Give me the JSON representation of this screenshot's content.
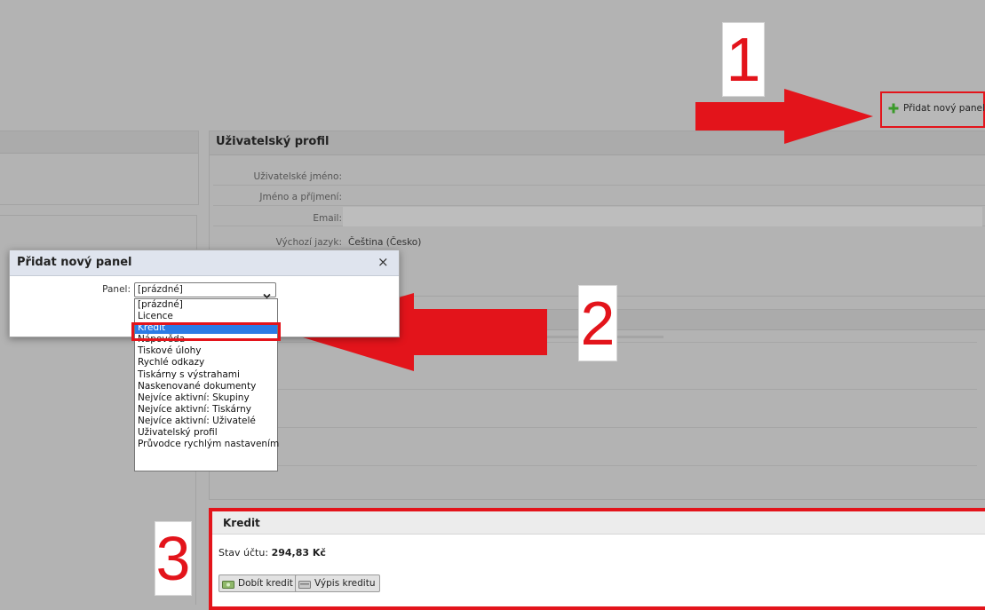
{
  "toolbar": {
    "add_panel_label": "Přidat nový panel"
  },
  "profile_panel": {
    "title": "Uživatelský profil",
    "rows": [
      {
        "label": "Uživatelské jméno:",
        "value": ""
      },
      {
        "label": "Jméno a příjmení:",
        "value": ""
      },
      {
        "label": "Email:",
        "value": ""
      },
      {
        "label": "Výchozí jazyk:",
        "value": "Čeština (Česko)"
      }
    ]
  },
  "dialog": {
    "title": "Přidat nový panel",
    "close_glyph": "×",
    "panel_label": "Panel:",
    "selected_value": "[prázdné]",
    "options": [
      "[prázdné]",
      "Licence",
      "Kredit",
      "Nápověda",
      "Tiskové úlohy",
      "Rychlé odkazy",
      "Tiskárny s výstrahami",
      "Naskenované dokumenty",
      "Nejvíce aktivní: Skupiny",
      "Nejvíce aktivní: Tiskárny",
      "Nejvíce aktivní: Uživatelé",
      "Uživatelský profil",
      "Průvodce rychlým nastavením"
    ],
    "highlighted_option": "Kredit"
  },
  "credit_panel": {
    "title": "Kredit",
    "balance_label": "Stav účtu:",
    "balance_value": "294,83 Kč",
    "topup_button": "Dobít kredit",
    "statement_button": "Výpis kreditu"
  },
  "annotations": {
    "step1": "1",
    "step2": "2",
    "step3": "3",
    "color": "#e3141b"
  },
  "icons": {
    "add": "plus-icon",
    "close": "close-icon",
    "topup": "money-icon",
    "statement": "card-icon",
    "select": "chevron-down-icon"
  }
}
